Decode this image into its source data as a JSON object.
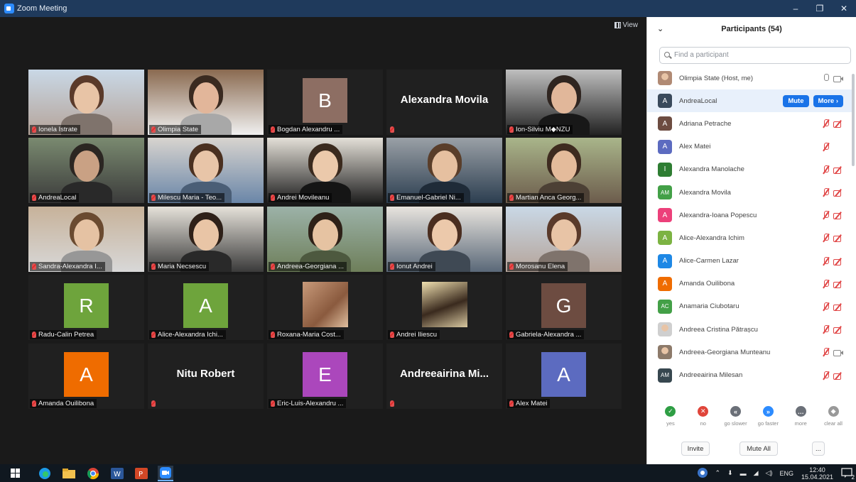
{
  "window": {
    "title": "Zoom Meeting",
    "minimize": "–",
    "maximize": "❐",
    "close": "✕"
  },
  "meeting": {
    "view_label": "View",
    "tiles": [
      {
        "name": "Ionela Istrate",
        "kind": "video"
      },
      {
        "name": "Olimpia State",
        "kind": "video"
      },
      {
        "name": "Bogdan Alexandru ...",
        "kind": "avatar",
        "letter": "B",
        "color": "#8d6e63"
      },
      {
        "name": "",
        "kind": "name",
        "big": "Alexandra Movila"
      },
      {
        "name": "Ion-Silviu M◆NZU",
        "kind": "video"
      },
      {
        "name": "AndreaLocal",
        "kind": "video",
        "active": true
      },
      {
        "name": "Milescu Maria - Teo...",
        "kind": "video"
      },
      {
        "name": "Andrei Movileanu",
        "kind": "video"
      },
      {
        "name": "Emanuel-Gabriel Ni...",
        "kind": "video"
      },
      {
        "name": "Martian Anca Georg...",
        "kind": "video"
      },
      {
        "name": "Sandra-Alexandra I...",
        "kind": "video"
      },
      {
        "name": "Maria Necsescu",
        "kind": "video"
      },
      {
        "name": "Andreea-Georgiana ...",
        "kind": "video"
      },
      {
        "name": "Ionut Andrei",
        "kind": "video"
      },
      {
        "name": "Morosanu Elena",
        "kind": "video"
      },
      {
        "name": "Radu-Calin Petrea",
        "kind": "avatar",
        "letter": "R",
        "color": "#6ea43c"
      },
      {
        "name": "Alice-Alexandra Ichi...",
        "kind": "avatar",
        "letter": "A",
        "color": "#6ea43c"
      },
      {
        "name": "Roxana-Maria Cost...",
        "kind": "photo"
      },
      {
        "name": "Andrei Iliescu",
        "kind": "photo"
      },
      {
        "name": "Gabriela-Alexandra ...",
        "kind": "avatar",
        "letter": "G",
        "color": "#6d4c41"
      },
      {
        "name": "Amanda Ouilibona",
        "kind": "avatar",
        "letter": "A",
        "color": "#ef6c00"
      },
      {
        "name": "",
        "kind": "name",
        "big": "Nitu Robert"
      },
      {
        "name": "Eric-Luis-Alexandru ...",
        "kind": "avatar",
        "letter": "E",
        "color": "#ab47bc"
      },
      {
        "name": "",
        "kind": "name",
        "big": "Andreeairina Mi..."
      },
      {
        "name": "Alex Matei",
        "kind": "avatar",
        "letter": "A",
        "color": "#5c6bc0"
      }
    ]
  },
  "panel": {
    "title": "Participants (54)",
    "search_placeholder": "Find a participant",
    "participants": [
      {
        "name": "Olimpia State (Host, me)",
        "initials": "",
        "color": "#b08a74",
        "mic": "gray",
        "cam": "gray",
        "photo": true
      },
      {
        "name": "AndreaLocal",
        "initials": "A",
        "color": "#3a4a5c",
        "highlight": true,
        "mute_label": "Mute",
        "more_label": "More ›"
      },
      {
        "name": "Adriana Petrache",
        "initials": "A",
        "color": "#6d4c41",
        "mic": "red",
        "cam": "red"
      },
      {
        "name": "Alex Matei",
        "initials": "A",
        "color": "#5c6bc0",
        "mic": "red",
        "cam": ""
      },
      {
        "name": "Alexandra Manolache",
        "initials": "I",
        "color": "#2e7d32",
        "mic": "red",
        "cam": "red"
      },
      {
        "name": "Alexandra Movila",
        "initials": "AM",
        "color": "#43a047",
        "mic": "red",
        "cam": "red"
      },
      {
        "name": "Alexandra-Ioana Popescu",
        "initials": "A",
        "color": "#ec407a",
        "mic": "red",
        "cam": "red"
      },
      {
        "name": "Alice-Alexandra Ichim",
        "initials": "A",
        "color": "#7cb342",
        "mic": "red",
        "cam": "red"
      },
      {
        "name": "Alice-Carmen Lazar",
        "initials": "A",
        "color": "#1e88e5",
        "mic": "red",
        "cam": "red"
      },
      {
        "name": "Amanda Ouilibona",
        "initials": "A",
        "color": "#ef6c00",
        "mic": "red",
        "cam": "red"
      },
      {
        "name": "Anamaria Ciubotaru",
        "initials": "AC",
        "color": "#43a047",
        "mic": "red",
        "cam": "red"
      },
      {
        "name": "Andreea Cristina Pătrașcu",
        "initials": "",
        "color": "#cfcfcf",
        "mic": "red",
        "cam": "red",
        "photo": true
      },
      {
        "name": "Andreea-Georgiana Munteanu",
        "initials": "",
        "color": "#8d7a6a",
        "mic": "red",
        "cam": "gray",
        "photo": true
      },
      {
        "name": "Andreeairina Milesan",
        "initials": "AM",
        "color": "#37474f",
        "mic": "red",
        "cam": "red"
      }
    ],
    "reactions": [
      {
        "label": "yes",
        "symbol": "✓",
        "color": "#2e9e44"
      },
      {
        "label": "no",
        "symbol": "✕",
        "color": "#e0453a"
      },
      {
        "label": "go slower",
        "symbol": "«",
        "color": "#6b7078"
      },
      {
        "label": "go faster",
        "symbol": "»",
        "color": "#2d8cff"
      },
      {
        "label": "more",
        "symbol": "…",
        "color": "#6b7078"
      },
      {
        "label": "clear all",
        "symbol": "◆",
        "color": "#999999"
      }
    ],
    "invite_label": "Invite",
    "mute_all_label": "Mute All",
    "more_label": "..."
  },
  "taskbar": {
    "lang": "ENG",
    "time": "12:40",
    "date": "15.04.2021",
    "notif_count": "2"
  }
}
